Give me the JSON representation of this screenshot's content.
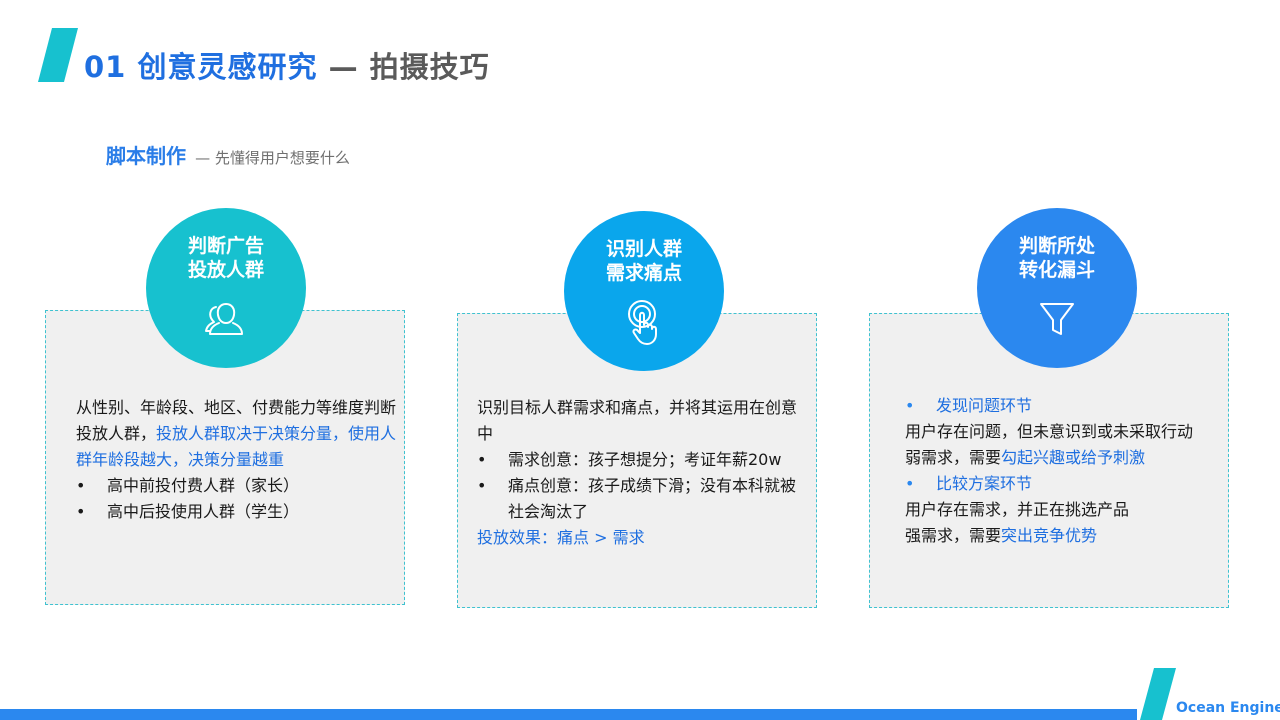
{
  "header": {
    "title_blue": "01 创意灵感研究",
    "title_gray": "— 拍摄技巧"
  },
  "subtitle": {
    "main": "脚本制作",
    "rest": "— 先懂得用户想要什么"
  },
  "cards": [
    {
      "circle_lines": [
        "判断广告",
        "投放人群"
      ],
      "icon": "users-icon",
      "circle_color": "#17c1cf",
      "text_1": "从性别、年龄段、地区、付费能力等维度判断投放人群，",
      "text_1_highlight": "投放人群取决于决策分量，使用人群年龄段越大，决策分量越重",
      "bullets": [
        "高中前投付费人群（家长）",
        "高中后投使用人群（学生）"
      ]
    },
    {
      "circle_lines": [
        "识别人群",
        "需求痛点"
      ],
      "icon": "touch-icon",
      "circle_color": "#0aa6ec",
      "intro": "识别目标人群需求和痛点，并将其运用在创意中",
      "bullets": [
        "需求创意：孩子想提分；考证年薪20w",
        "痛点创意：孩子成绩下滑；没有本科就被社会淘汰了"
      ],
      "effect": "投放效果：痛点 > 需求"
    },
    {
      "circle_lines": [
        "判断所处",
        "转化漏斗"
      ],
      "icon": "funnel-icon",
      "circle_color": "#2b88ef",
      "section1_head": "发现问题环节",
      "section1_line1": "用户存在问题，但未意识到或未采取行动",
      "section1_line2_prefix": "弱需求，需要",
      "section1_line2_hl": "勾起兴趣或给予刺激",
      "section2_head": "比较方案环节",
      "section2_line1": "用户存在需求，并正在挑选产品",
      "section2_line2_prefix": "强需求，需要",
      "section2_line2_hl": "突出竞争优势"
    }
  ],
  "bullet_char": "•",
  "footer": {
    "brand": "Ocean Engine"
  },
  "colors": {
    "accent": "#1f6fe0",
    "teal": "#17c1cf",
    "sky": "#0aa6ec",
    "blue": "#2b88ef",
    "card_bg": "#f0f0f0"
  }
}
